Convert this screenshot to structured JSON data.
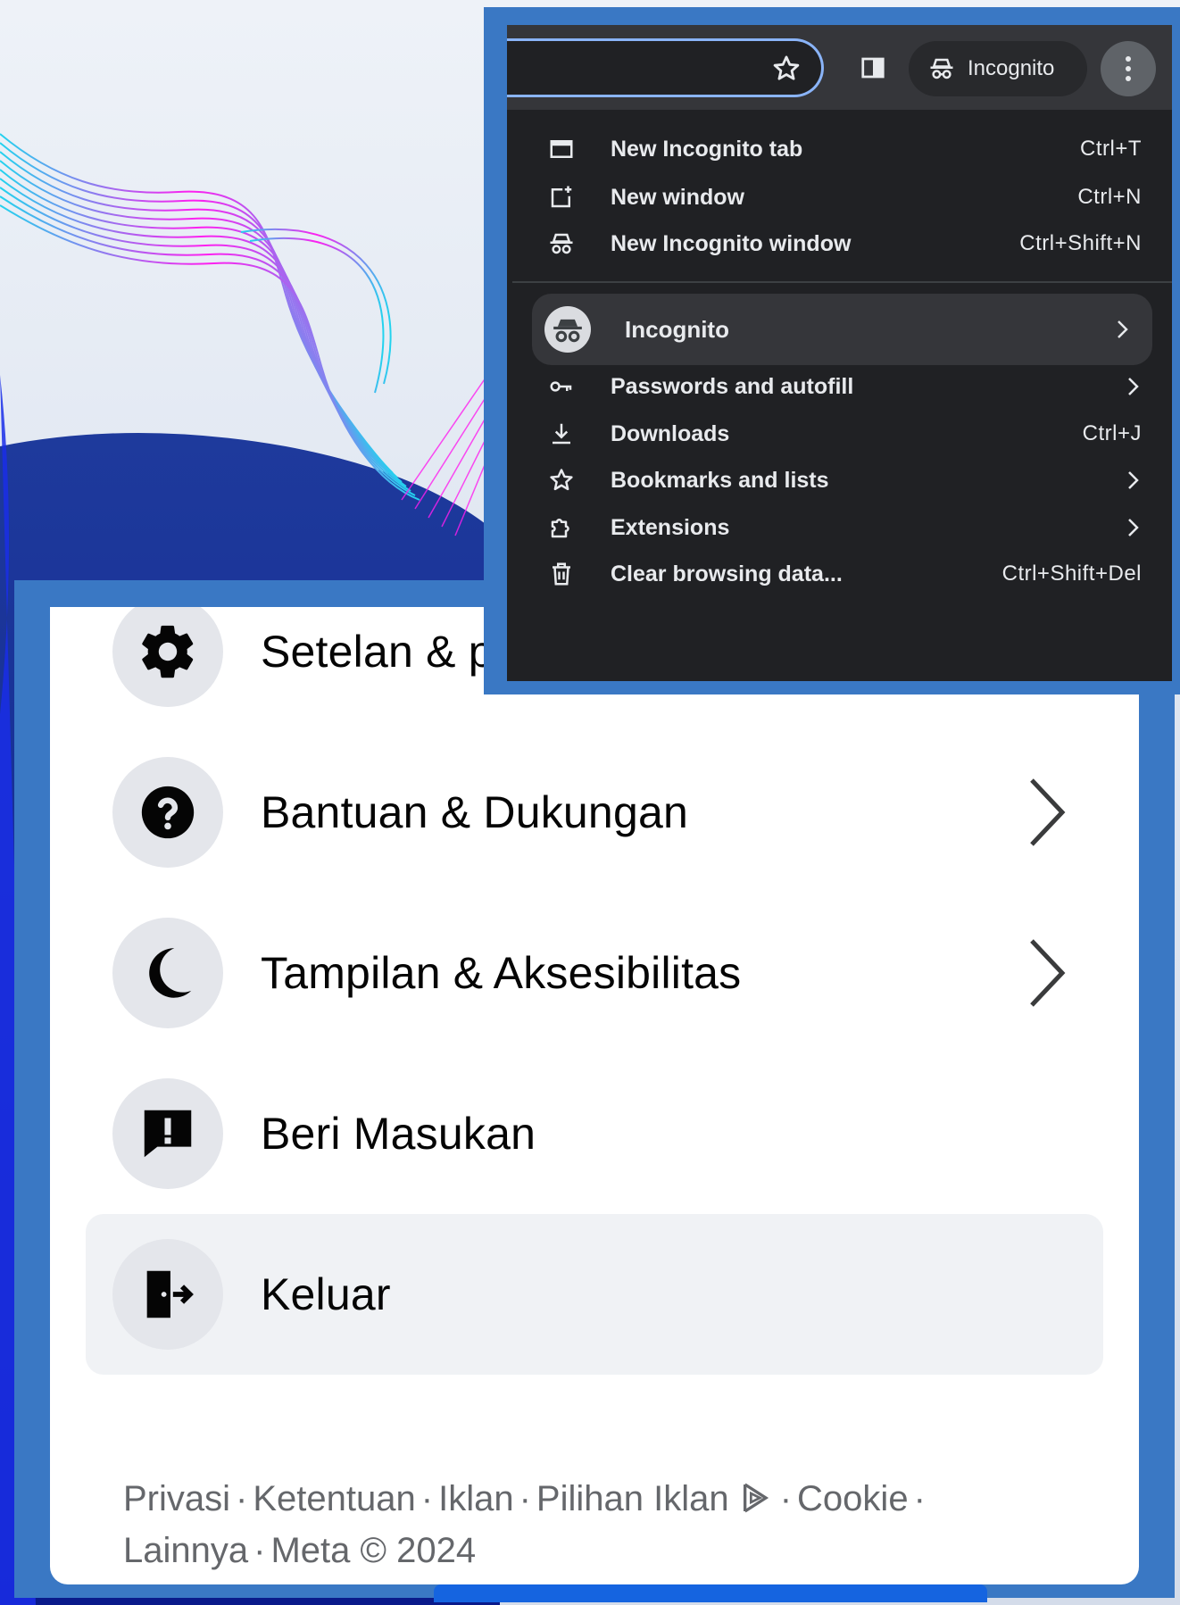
{
  "chrome": {
    "toolbar": {
      "incognito_label": "Incognito"
    },
    "menu_items": [
      {
        "label": "New Incognito tab",
        "shortcut": "Ctrl+T",
        "icon": "new-tab-icon"
      },
      {
        "label": "New window",
        "shortcut": "Ctrl+N",
        "icon": "new-window-icon"
      },
      {
        "label": "New Incognito window",
        "shortcut": "Ctrl+Shift+N",
        "icon": "incognito-icon"
      }
    ],
    "profile_item": {
      "label": "Incognito",
      "icon": "incognito-avatar-icon"
    },
    "menu_items_2": [
      {
        "label": "Passwords and autofill",
        "shortcut": "",
        "icon": "key-icon",
        "submenu": true
      },
      {
        "label": "Downloads",
        "shortcut": "Ctrl+J",
        "icon": "download-icon",
        "submenu": false
      },
      {
        "label": "Bookmarks and lists",
        "shortcut": "",
        "icon": "star-icon",
        "submenu": true
      },
      {
        "label": "Extensions",
        "shortcut": "",
        "icon": "puzzle-icon",
        "submenu": true
      },
      {
        "label": "Clear browsing data...",
        "shortcut": "Ctrl+Shift+Del",
        "icon": "trash-icon",
        "submenu": false
      }
    ]
  },
  "facebook": {
    "menu_items": [
      {
        "label": "Setelan & privasi",
        "icon": "gear-icon",
        "submenu": true
      },
      {
        "label": "Bantuan & Dukungan",
        "icon": "help-icon",
        "submenu": true
      },
      {
        "label": "Tampilan & Aksesibilitas",
        "icon": "moon-icon",
        "submenu": true
      },
      {
        "label": "Beri Masukan",
        "icon": "feedback-icon",
        "submenu": false
      },
      {
        "label": "Keluar",
        "icon": "logout-icon",
        "submenu": false
      }
    ],
    "footer": {
      "links": [
        "Privasi",
        "Ketentuan",
        "Iklan",
        "Pilihan Iklan",
        "Cookie",
        "Lainnya"
      ],
      "copyright": "Meta © 2024",
      "separator": "·"
    }
  },
  "colors": {
    "frame_blue": "#3a78c4",
    "chrome_bg": "#202124",
    "chrome_focus": "#8ab4f8",
    "fb_icon_bg": "#e4e6eb",
    "fb_highlight": "#f0f2f5"
  }
}
